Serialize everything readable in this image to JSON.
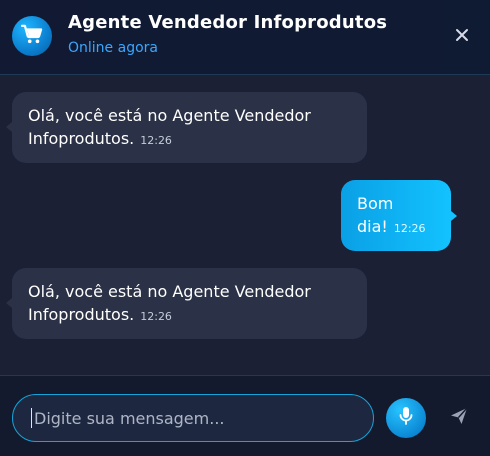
{
  "header": {
    "title": "Agente Vendedor Infoprodutos",
    "status": "Online agora",
    "avatar_icon": "shopping-cart-icon",
    "close_icon": "close-icon"
  },
  "messages": [
    {
      "sender": "bot",
      "text_line1": "Olá, você está no Agente Vendedor",
      "text_line2": "Infoprodutos.",
      "time": "12:26"
    },
    {
      "sender": "user",
      "text_line1": "Bom",
      "text_line2": "dia!",
      "time": "12:26"
    },
    {
      "sender": "bot",
      "text_line1": "Olá, você está no Agente Vendedor",
      "text_line2": "Infoprodutos.",
      "time": "12:26"
    }
  ],
  "composer": {
    "placeholder": "Digite sua mensagem...",
    "mic_icon": "microphone-icon",
    "send_icon": "send-icon"
  },
  "colors": {
    "accent": "#13c2ff",
    "status": "#39a7ff",
    "bot_bubble": "#2b3146",
    "background": "#1b2035"
  }
}
